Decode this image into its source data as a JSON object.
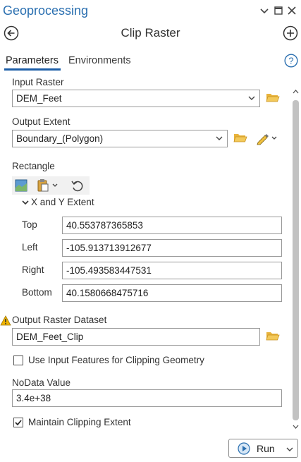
{
  "pane": {
    "title": "Geoprocessing",
    "window_icons": [
      "chevron-down-icon",
      "maximize-icon",
      "close-icon"
    ]
  },
  "tool": {
    "title": "Clip Raster",
    "back_icon": "back-arrow-icon",
    "add_icon": "add-icon"
  },
  "tabs": [
    {
      "label": "Parameters",
      "active": true
    },
    {
      "label": "Environments",
      "active": false
    }
  ],
  "help_icon": "help-icon",
  "input_raster": {
    "label": "Input Raster",
    "value": "DEM_Feet"
  },
  "output_extent": {
    "label": "Output Extent",
    "value": "Boundary_(Polygon)"
  },
  "rectangle": {
    "label": "Rectangle",
    "extent_label": "X and Y Extent",
    "top": {
      "label": "Top",
      "value": "40.553787365853"
    },
    "left": {
      "label": "Left",
      "value": "-105.913713912677"
    },
    "right": {
      "label": "Right",
      "value": "-105.493583447531"
    },
    "bottom": {
      "label": "Bottom",
      "value": "40.1580668475716"
    }
  },
  "output_raster": {
    "label": "Output Raster Dataset",
    "value": "DEM_Feet_Clip",
    "warning": true
  },
  "use_input_features": {
    "label": "Use Input Features for Clipping Geometry",
    "checked": false
  },
  "nodata": {
    "label": "NoData Value",
    "value": "3.4e+38"
  },
  "maintain_extent": {
    "label": "Maintain Clipping Extent",
    "checked": true
  },
  "run": {
    "label": "Run"
  },
  "colors": {
    "accent": "#2a6fb0",
    "folder": "#e8b33c",
    "warning": "#f0b400"
  }
}
